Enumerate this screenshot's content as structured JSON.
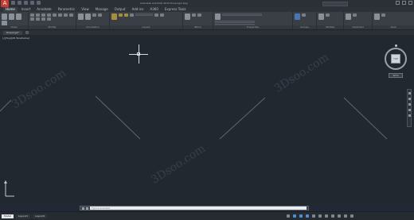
{
  "app": {
    "window_title": "Autodesk AutoCAD 2016  Drawing1.dwg",
    "app_button_label": "A"
  },
  "ribbon_tabs": [
    "Home",
    "Insert",
    "Annotate",
    "Parametric",
    "View",
    "Manage",
    "Output",
    "Add-ins",
    "A360",
    "Express Tools"
  ],
  "ribbon_panels": [
    "Draw",
    "Modify",
    "Annotation",
    "Layers",
    "Block",
    "Properties",
    "Groups",
    "Utilities",
    "Clipboard",
    "View"
  ],
  "file_tab": {
    "label": "Drawing1*"
  },
  "viewport": {
    "label": "[-][Top][2D Wireframe]",
    "watermark": "3Dsoo.com"
  },
  "viewcube": {
    "face": "TOP",
    "wcs_label": "WCS"
  },
  "command": {
    "placeholder": "Type a command"
  },
  "layout_tabs": [
    "Model",
    "Layout1",
    "Layout2"
  ],
  "colors": {
    "canvas": "#212830",
    "ribbon": "#3a3f46",
    "app_button": "#c73a2f"
  }
}
